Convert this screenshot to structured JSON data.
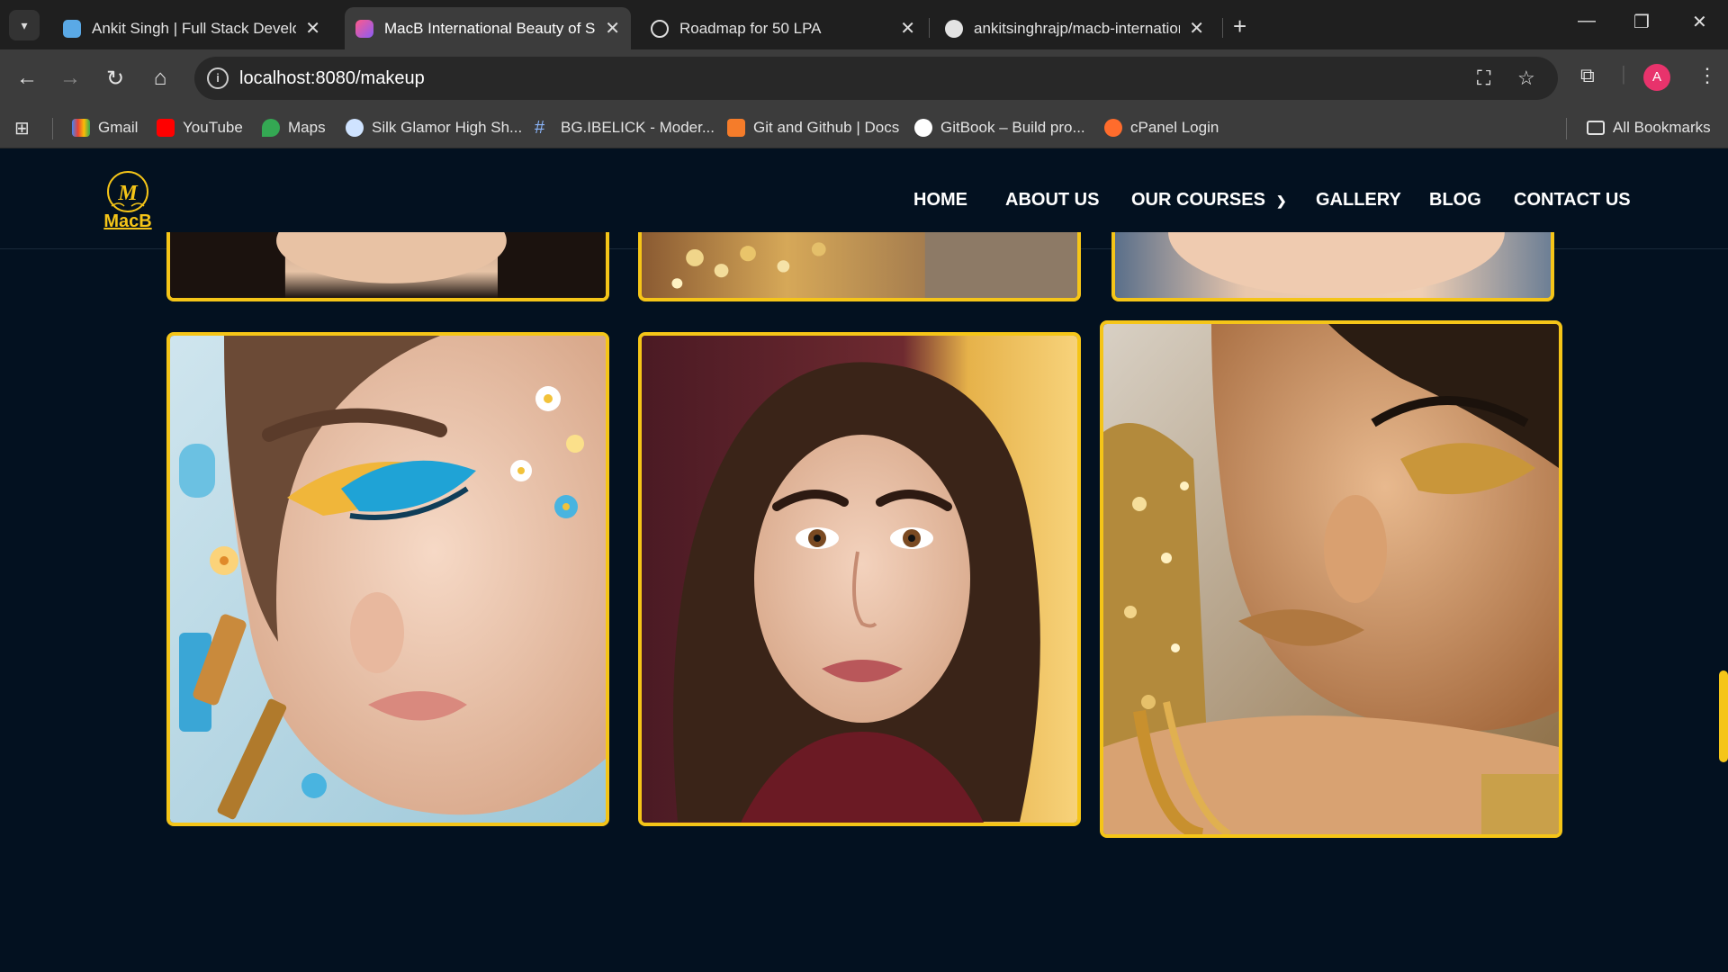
{
  "browser": {
    "tabs": [
      {
        "title": "Ankit Singh | Full Stack Developer",
        "active": false
      },
      {
        "title": "MacB International Beauty of School",
        "active": true
      },
      {
        "title": "Roadmap for 50 LPA",
        "active": false
      },
      {
        "title": "ankitsinghrajp/macb-international",
        "active": false
      }
    ],
    "url": "localhost:8080/makeup",
    "bookmarks": [
      {
        "label": "Gmail"
      },
      {
        "label": "YouTube"
      },
      {
        "label": "Maps"
      },
      {
        "label": "Silk Glamor High Sh..."
      },
      {
        "label": "BG.IBELICK - Moder..."
      },
      {
        "label": "Git and Github | Docs"
      },
      {
        "label": "GitBook – Build pro..."
      },
      {
        "label": "cPanel Login"
      }
    ],
    "all_bookmarks": "All Bookmarks",
    "avatar_letter": "A"
  },
  "site": {
    "logo_text": "MacB",
    "nav": [
      {
        "label": "HOME"
      },
      {
        "label": "ABOUT US"
      },
      {
        "label": "OUR COURSES"
      },
      {
        "label": "GALLERY"
      },
      {
        "label": "BLOG"
      },
      {
        "label": "CONTACT US"
      }
    ]
  },
  "colors": {
    "page_bg": "#031120",
    "accent": "#f5c518"
  }
}
